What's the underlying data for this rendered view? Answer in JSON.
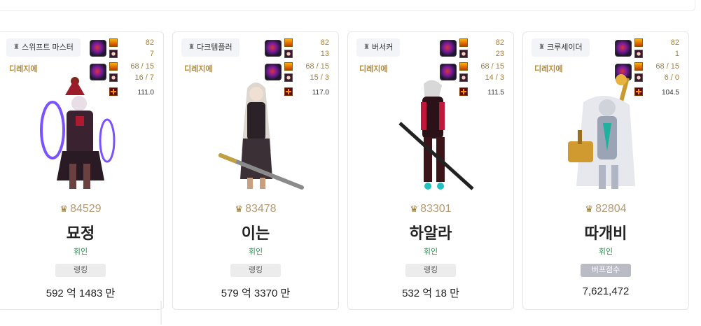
{
  "cards": [
    {
      "class_name": "스위프트 마스터",
      "role": "디레지에",
      "equip": {
        "top_a": "82",
        "top_b": "7",
        "mid_a": "68 / 15",
        "mid_b": "16 / 7",
        "bottom": "111.0"
      },
      "score": "84529",
      "name": "묘정",
      "guild": "휘인",
      "badge": "랭킹",
      "value": "592 억 1483 만",
      "avatar": "swift-master-avatar"
    },
    {
      "class_name": "다크템플러",
      "role": "디레지에",
      "equip": {
        "top_a": "82",
        "top_b": "13",
        "mid_a": "68 / 15",
        "mid_b": "15 / 3",
        "bottom": "117.0"
      },
      "score": "83478",
      "name": "이는",
      "guild": "휘인",
      "badge": "랭킹",
      "value": "579 억 3370 만",
      "avatar": "dark-templar-avatar"
    },
    {
      "class_name": "버서커",
      "role": "디레지에",
      "equip": {
        "top_a": "82",
        "top_b": "23",
        "mid_a": "68 / 15",
        "mid_b": "14 / 3",
        "bottom": "111.5"
      },
      "score": "83301",
      "name": "하알라",
      "guild": "휘인",
      "badge": "랭킹",
      "value": "532 억 18 만",
      "avatar": "berserker-avatar"
    },
    {
      "class_name": "크루세이더",
      "role": "디레지에",
      "equip": {
        "top_a": "82",
        "top_b": "1",
        "mid_a": "68 / 15",
        "mid_b": "6 / 0",
        "bottom": "104.5"
      },
      "score": "82804",
      "name": "따개비",
      "guild": "휘인",
      "badge": "버프점수",
      "value": "7,621,472",
      "avatar": "crusader-avatar"
    }
  ],
  "colors": {
    "gold": "#b58a3a",
    "score": "#b49a72",
    "guild": "#2f8f53",
    "badge_gray": "#ececec",
    "buff_badge": "#b9bcc4"
  }
}
